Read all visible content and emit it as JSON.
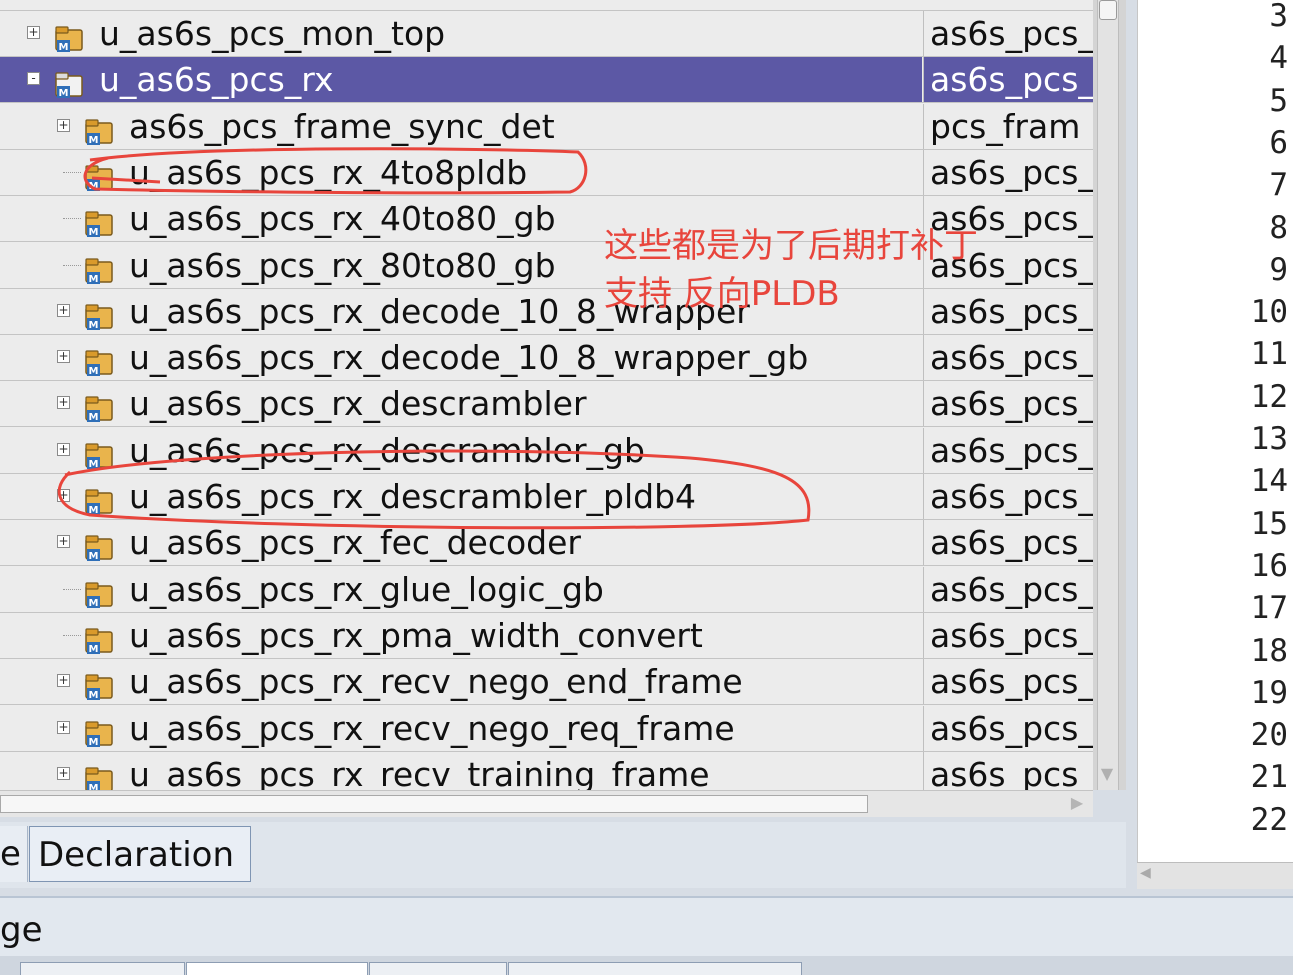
{
  "tree_rows": [
    {
      "name": "u_as6s_pcs_mon_top",
      "type": "as6s_pcs_",
      "expander": "+",
      "selected": false
    },
    {
      "name": "u_as6s_pcs_rx",
      "type": "as6s_pcs_",
      "expander": "-",
      "selected": true
    },
    {
      "name": "as6s_pcs_frame_sync_det",
      "type": "pcs_fram",
      "expander": "+",
      "selected": false
    },
    {
      "name": "u_as6s_pcs_rx_4to8pldb",
      "type": "as6s_pcs_",
      "expander": "",
      "selected": false
    },
    {
      "name": "u_as6s_pcs_rx_40to80_gb",
      "type": "as6s_pcs_",
      "expander": "",
      "selected": false
    },
    {
      "name": "u_as6s_pcs_rx_80to80_gb",
      "type": "as6s_pcs_",
      "expander": "",
      "selected": false
    },
    {
      "name": "u_as6s_pcs_rx_decode_10_8_wrapper",
      "type": "as6s_pcs_",
      "expander": "+",
      "selected": false
    },
    {
      "name": "u_as6s_pcs_rx_decode_10_8_wrapper_gb",
      "type": "as6s_pcs_",
      "expander": "+",
      "selected": false
    },
    {
      "name": "u_as6s_pcs_rx_descrambler",
      "type": "as6s_pcs_",
      "expander": "+",
      "selected": false
    },
    {
      "name": "u_as6s_pcs_rx_descrambler_gb",
      "type": "as6s_pcs_",
      "expander": "+",
      "selected": false
    },
    {
      "name": "u_as6s_pcs_rx_descrambler_pldb4",
      "type": "as6s_pcs_",
      "expander": "+",
      "selected": false
    },
    {
      "name": "u_as6s_pcs_rx_fec_decoder",
      "type": "as6s_pcs_",
      "expander": "+",
      "selected": false
    },
    {
      "name": "u_as6s_pcs_rx_glue_logic_gb",
      "type": "as6s_pcs_",
      "expander": "",
      "selected": false
    },
    {
      "name": "u_as6s_pcs_rx_pma_width_convert",
      "type": "as6s_pcs_",
      "expander": "",
      "selected": false
    },
    {
      "name": "u_as6s_pcs_rx_recv_nego_end_frame",
      "type": "as6s_pcs_",
      "expander": "+",
      "selected": false
    },
    {
      "name": "u_as6s_pcs_rx_recv_nego_req_frame",
      "type": "as6s_pcs_",
      "expander": "+",
      "selected": false
    },
    {
      "name": "u_as6s_pcs_rx_recv_training_frame",
      "type": "as6s_pcs_",
      "expander": "+",
      "selected": false
    }
  ],
  "line_numbers": [
    "3",
    "4",
    "5",
    "6",
    "7",
    "8",
    "9",
    "10",
    "11",
    "12",
    "13",
    "14",
    "15",
    "16",
    "17",
    "18",
    "19",
    "20",
    "21",
    "22"
  ],
  "tabs": {
    "partial": "e",
    "declaration": "Declaration"
  },
  "bottom_label": "ge",
  "annotation": {
    "line1": "这些都是为了后期打补丁",
    "line2": "支持 反向PLDB",
    "color": "#e8453c"
  },
  "colors": {
    "selection": "#5c58a5",
    "panel": "#ececec"
  }
}
